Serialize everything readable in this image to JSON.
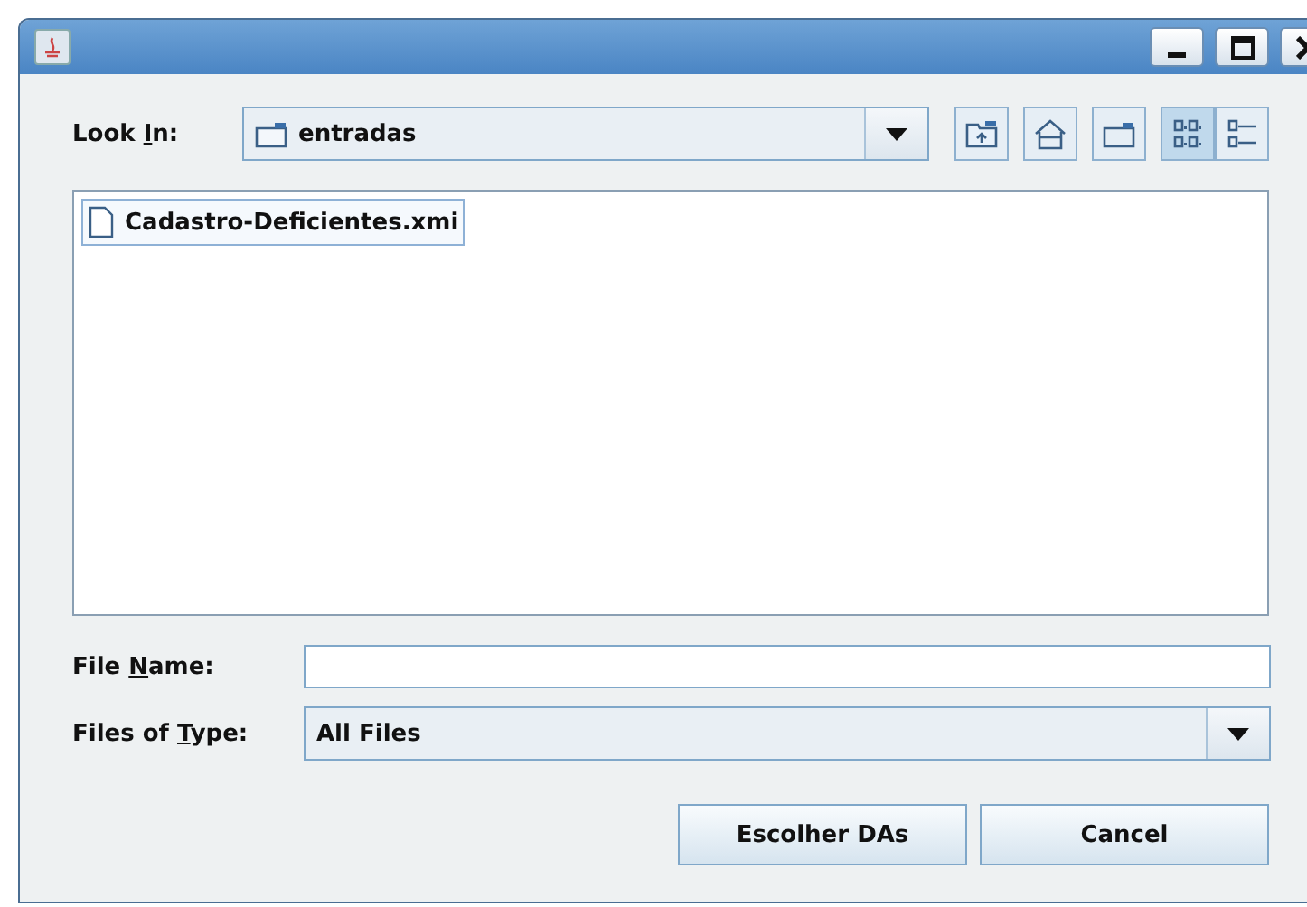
{
  "window": {
    "title_buttons": [
      {
        "kind": "minimize"
      },
      {
        "kind": "maximize"
      },
      {
        "kind": "close"
      }
    ]
  },
  "look_in": {
    "label": {
      "before": "Look ",
      "mnemonic": "I",
      "after": "n:"
    },
    "value": "entradas"
  },
  "toolbar": [
    {
      "kind": "up"
    },
    {
      "kind": "home"
    },
    {
      "kind": "new-folder"
    },
    {
      "kind": "list",
      "selected": true
    },
    {
      "kind": "details",
      "selected": false
    }
  ],
  "files": [
    {
      "name": "Cadastro-Deficientes.xmi",
      "selected": true
    }
  ],
  "file_name": {
    "label": {
      "before": "File ",
      "mnemonic": "N",
      "after": "ame:"
    }
  },
  "file_type": {
    "label": {
      "before": "Files of ",
      "mnemonic": "T",
      "after": "ype:"
    },
    "value": "All Files"
  },
  "buttons": [
    "Escolher DAs",
    "Cancel"
  ]
}
